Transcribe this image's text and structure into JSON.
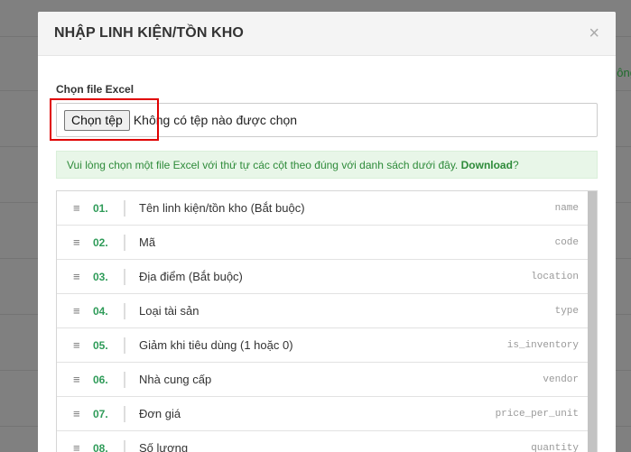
{
  "background": {
    "edge_text": "ông"
  },
  "modal": {
    "title": "NHẬP LINH KIỆN/TỒN KHO",
    "close_symbol": "×",
    "file_label": "Chọn file Excel",
    "file_button": "Chọn tệp",
    "file_status": "Không có tệp nào được chọn",
    "info_text": "Vui lòng chọn một file Excel với thứ tự các cột theo đúng với danh sách dưới đây.",
    "info_link": "Download",
    "info_suffix": "?",
    "columns": [
      {
        "num": "01.",
        "label": "Tên linh kiện/tồn kho (Bắt buộc)",
        "key": "name"
      },
      {
        "num": "02.",
        "label": "Mã",
        "key": "code"
      },
      {
        "num": "03.",
        "label": "Địa điểm (Bắt buộc)",
        "key": "location"
      },
      {
        "num": "04.",
        "label": "Loại tài sản",
        "key": "type"
      },
      {
        "num": "05.",
        "label": "Giảm khi tiêu dùng (1 hoặc 0)",
        "key": "is_inventory"
      },
      {
        "num": "06.",
        "label": "Nhà cung cấp",
        "key": "vendor"
      },
      {
        "num": "07.",
        "label": "Đơn giá",
        "key": "price_per_unit"
      },
      {
        "num": "08.",
        "label": "Số lượng",
        "key": "quantity"
      }
    ],
    "drag_icon": "≡"
  }
}
